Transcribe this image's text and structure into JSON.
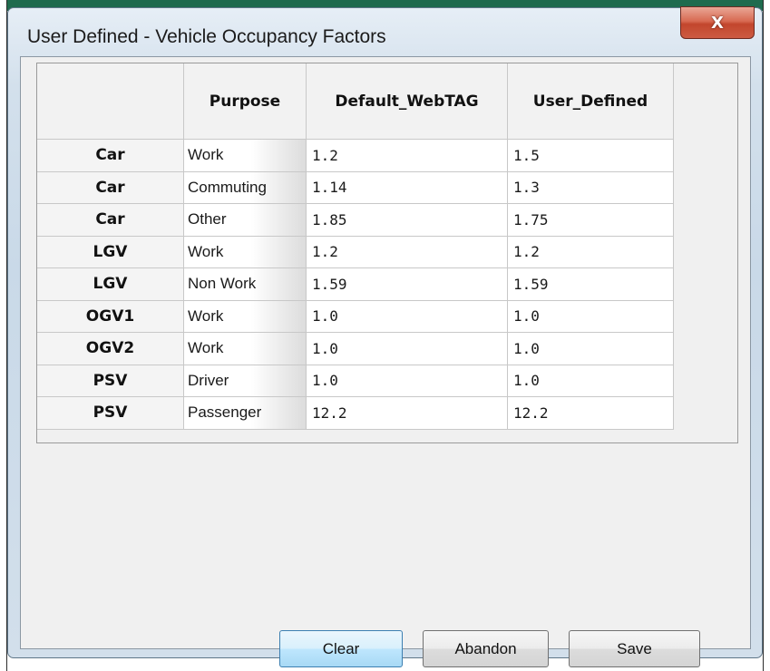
{
  "window": {
    "title": "User Defined - Vehicle Occupancy Factors",
    "close_glyph": "X",
    "close_icon": "close-icon"
  },
  "table": {
    "columns": [
      "",
      "Purpose",
      "Default_WebTAG",
      "User_Defined"
    ],
    "rows": [
      {
        "vehicle": "Car",
        "purpose": "Work",
        "default_webtag": "1.2",
        "user_defined": "1.5"
      },
      {
        "vehicle": "Car",
        "purpose": "Commuting",
        "default_webtag": "1.14",
        "user_defined": "1.3"
      },
      {
        "vehicle": "Car",
        "purpose": "Other",
        "default_webtag": "1.85",
        "user_defined": "1.75"
      },
      {
        "vehicle": "LGV",
        "purpose": "Work",
        "default_webtag": "1.2",
        "user_defined": "1.2"
      },
      {
        "vehicle": "LGV",
        "purpose": "Non Work",
        "default_webtag": "1.59",
        "user_defined": "1.59"
      },
      {
        "vehicle": "OGV1",
        "purpose": "Work",
        "default_webtag": "1.0",
        "user_defined": "1.0"
      },
      {
        "vehicle": "OGV2",
        "purpose": "Work",
        "default_webtag": "1.0",
        "user_defined": "1.0"
      },
      {
        "vehicle": "PSV",
        "purpose": "Driver",
        "default_webtag": "1.0",
        "user_defined": "1.0"
      },
      {
        "vehicle": "PSV",
        "purpose": "Passenger",
        "default_webtag": "12.2",
        "user_defined": "12.2"
      }
    ]
  },
  "buttons": {
    "clear": "Clear",
    "abandon": "Abandon",
    "save": "Save"
  },
  "colors": {
    "title_bar_top": "#1f6b4e",
    "close_button": "#c2462d",
    "default_button": "#bee6fd"
  }
}
